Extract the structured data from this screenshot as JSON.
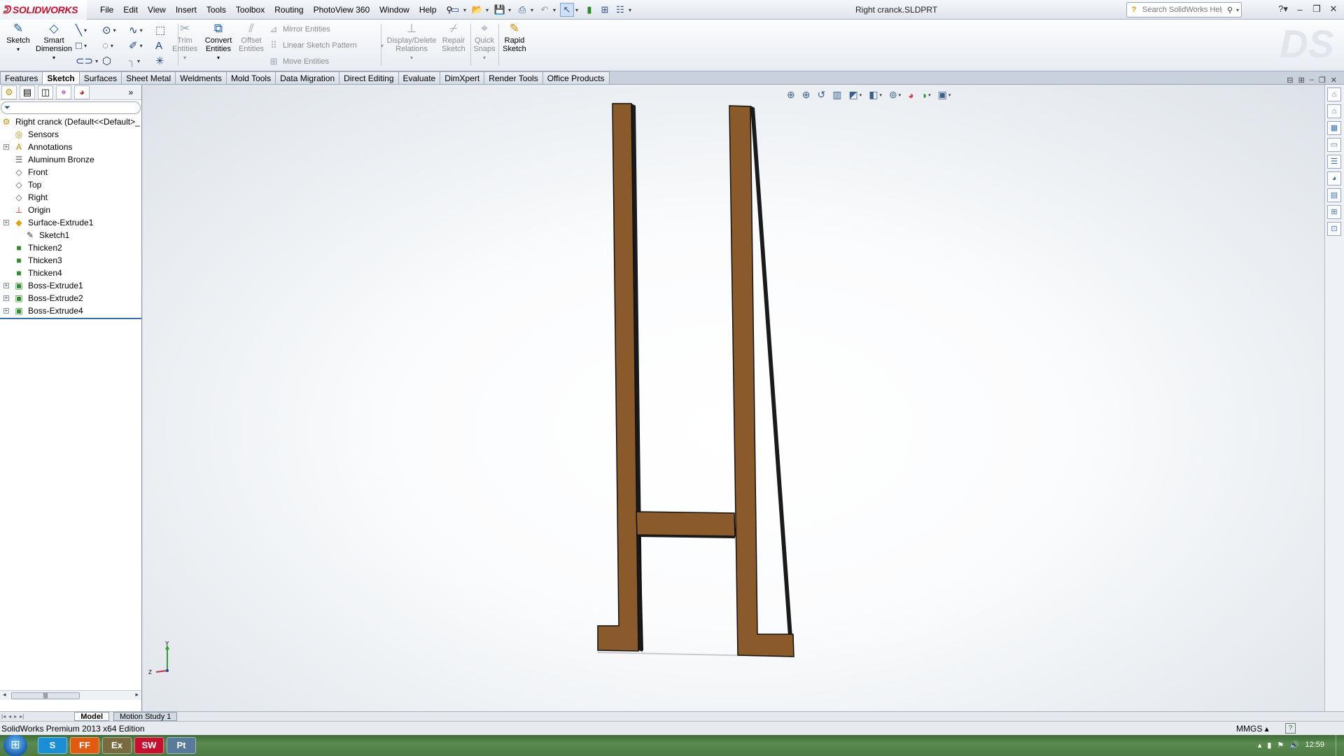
{
  "app": {
    "brand": "SOLIDWORKS",
    "document_title": "Right cranck.SLDPRT"
  },
  "menu": [
    "File",
    "Edit",
    "View",
    "Insert",
    "Tools",
    "Toolbox",
    "Routing",
    "PhotoView 360",
    "Window",
    "Help"
  ],
  "search": {
    "placeholder": "Search SolidWorks Help"
  },
  "command_manager": {
    "sketch": "Sketch",
    "smart_dimension": [
      "Smart",
      "Dimension"
    ],
    "trim_entities": [
      "Trim",
      "Entities"
    ],
    "convert_entities": [
      "Convert",
      "Entities"
    ],
    "offset_entities": [
      "Offset",
      "Entities"
    ],
    "mirror_entities": "Mirror Entities",
    "linear_sketch_pattern": "Linear Sketch Pattern",
    "move_entities": "Move Entities",
    "display_delete_relations": [
      "Display/Delete",
      "Relations"
    ],
    "repair_sketch": [
      "Repair",
      "Sketch"
    ],
    "quick_snaps": [
      "Quick",
      "Snaps"
    ],
    "rapid_sketch": [
      "Rapid",
      "Sketch"
    ]
  },
  "tabs": [
    {
      "label": "Features",
      "active": false
    },
    {
      "label": "Sketch",
      "active": true
    },
    {
      "label": "Surfaces",
      "active": false
    },
    {
      "label": "Sheet Metal",
      "active": false
    },
    {
      "label": "Weldments",
      "active": false
    },
    {
      "label": "Mold Tools",
      "active": false
    },
    {
      "label": "Data Migration",
      "active": false
    },
    {
      "label": "Direct Editing",
      "active": false
    },
    {
      "label": "Evaluate",
      "active": false
    },
    {
      "label": "DimXpert",
      "active": false
    },
    {
      "label": "Render Tools",
      "active": false
    },
    {
      "label": "Office Products",
      "active": false
    }
  ],
  "feature_tree": {
    "root": "Right cranck  (Default<<Default>_",
    "items": [
      {
        "label": "Sensors",
        "icon": "sensor-icon",
        "expandable": false,
        "indent": 1
      },
      {
        "label": "Annotations",
        "icon": "annotation-icon",
        "expandable": true,
        "indent": 1
      },
      {
        "label": "Aluminum Bronze",
        "icon": "material-icon",
        "expandable": false,
        "indent": 1
      },
      {
        "label": "Front",
        "icon": "plane-icon",
        "expandable": false,
        "indent": 1
      },
      {
        "label": "Top",
        "icon": "plane-icon",
        "expandable": false,
        "indent": 1
      },
      {
        "label": "Right",
        "icon": "plane-icon",
        "expandable": false,
        "indent": 1
      },
      {
        "label": "Origin",
        "icon": "origin-icon",
        "expandable": false,
        "indent": 1
      },
      {
        "label": "Surface-Extrude1",
        "icon": "surface-extrude-icon",
        "expandable": true,
        "indent": 1
      },
      {
        "label": "Sketch1",
        "icon": "sketch-icon",
        "expandable": false,
        "indent": 2
      },
      {
        "label": "Thicken2",
        "icon": "thicken-icon",
        "expandable": false,
        "indent": 1
      },
      {
        "label": "Thicken3",
        "icon": "thicken-icon",
        "expandable": false,
        "indent": 1
      },
      {
        "label": "Thicken4",
        "icon": "thicken-icon",
        "expandable": false,
        "indent": 1
      },
      {
        "label": "Boss-Extrude1",
        "icon": "boss-extrude-icon",
        "expandable": true,
        "indent": 1
      },
      {
        "label": "Boss-Extrude2",
        "icon": "boss-extrude-icon",
        "expandable": true,
        "indent": 1
      },
      {
        "label": "Boss-Extrude4",
        "icon": "boss-extrude-icon",
        "expandable": true,
        "indent": 1
      }
    ]
  },
  "model": {
    "color": "#8b5a2b",
    "edge_color": "#111111"
  },
  "triad": {
    "y_label": "Y",
    "z_label": "Z"
  },
  "bottom_tabs": [
    "Model",
    "Motion Study 1"
  ],
  "status": {
    "left": "SolidWorks Premium 2013 x64 Edition",
    "units": "MMGS"
  },
  "taskbar": {
    "apps": [
      "S",
      "FF",
      "Ex",
      "SW",
      "Pt"
    ],
    "time": "12:59"
  },
  "colors": {
    "accent": "#1f5aa6",
    "brand_red": "#c8102e"
  }
}
